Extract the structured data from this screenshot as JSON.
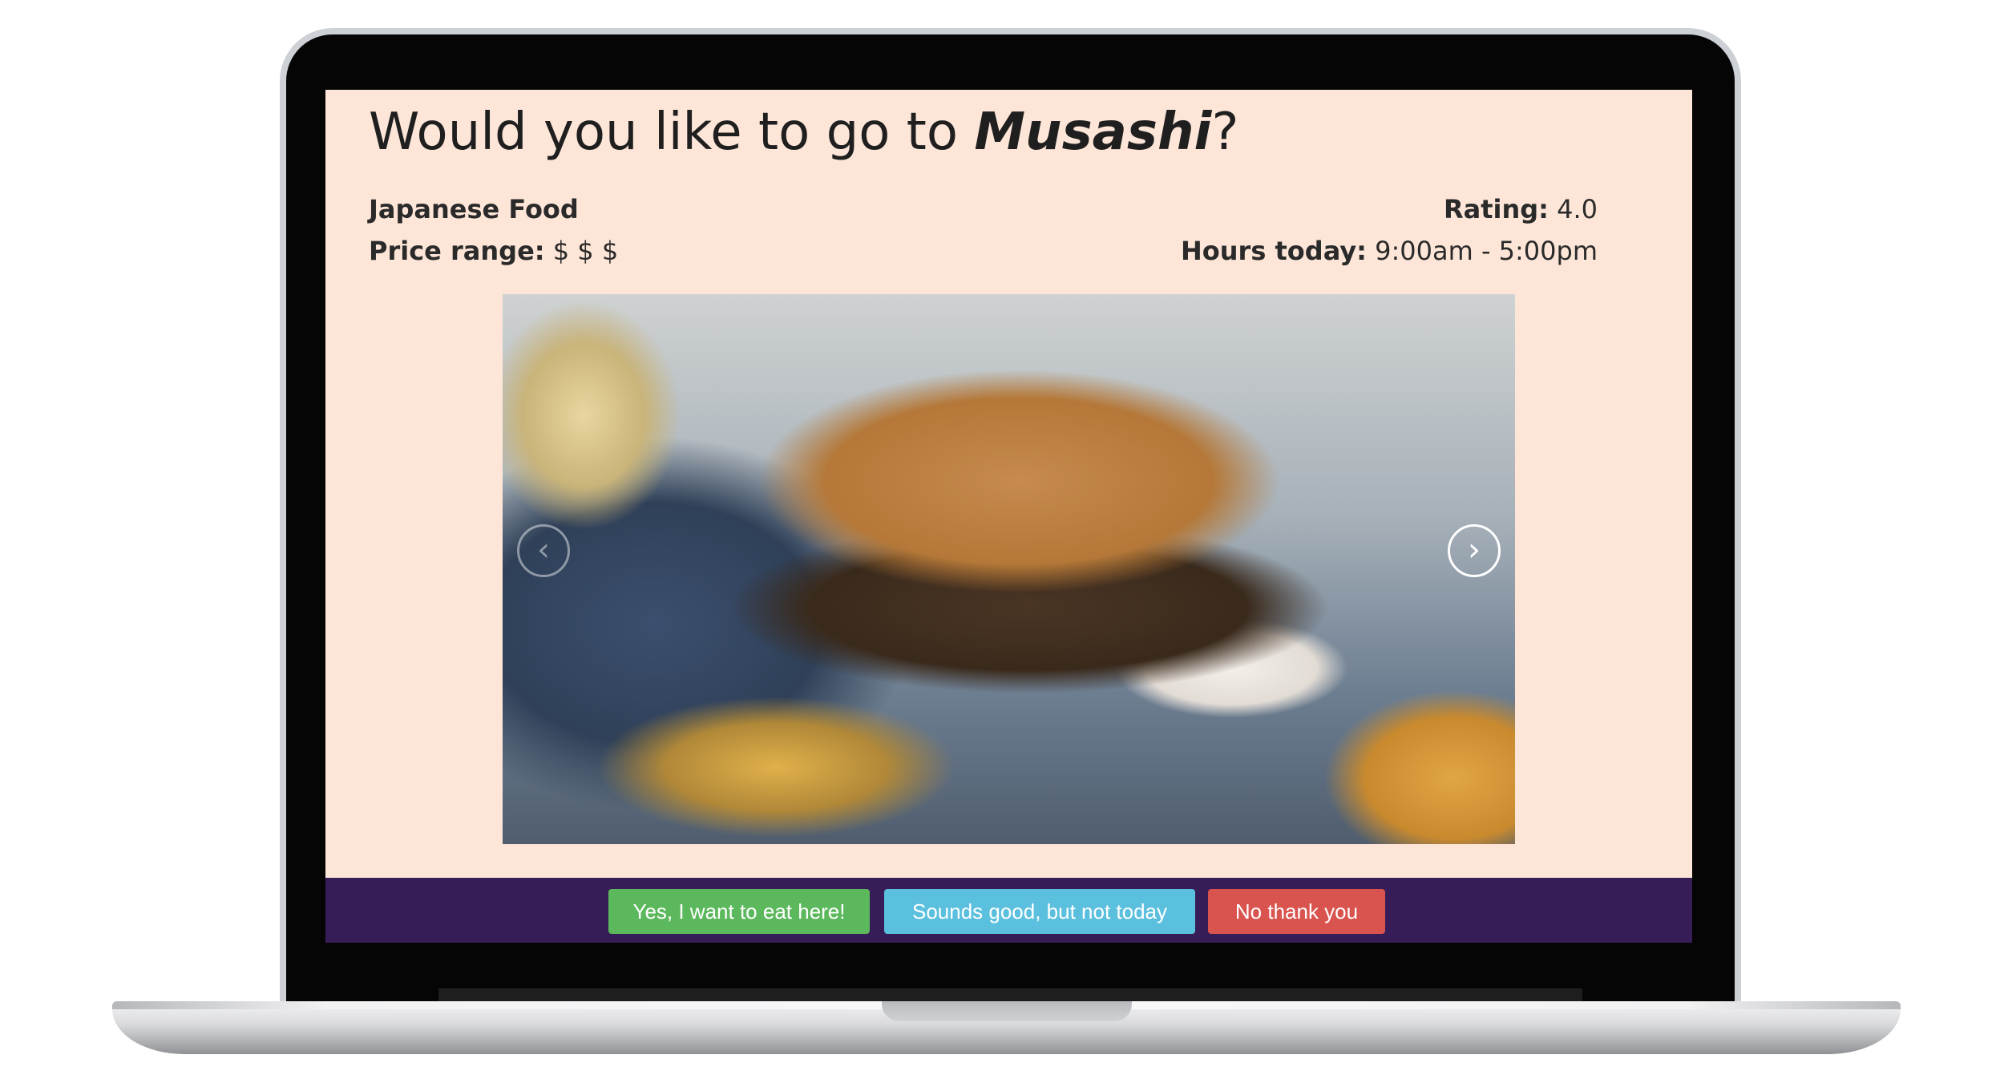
{
  "page": {
    "question_prefix": "Would you like to go to ",
    "restaurant_name": "Musashi",
    "question_suffix": "?"
  },
  "restaurant": {
    "cuisine": "Japanese Food",
    "price_label": "Price range:",
    "price_value": "$ $ $",
    "rating_label": "Rating:",
    "rating_value": "4.0",
    "hours_label": "Hours today:",
    "hours_value": "9:00am - 5:00pm"
  },
  "carousel": {
    "prev_icon": "chevron-left-icon",
    "next_icon": "chevron-right-icon",
    "prev_glyph": "‹",
    "next_glyph": "›"
  },
  "actions": {
    "yes_label": "Yes, I want to eat here!",
    "maybe_label": "Sounds good, but not today",
    "no_label": "No thank you"
  },
  "colors": {
    "content_bg": "#fde6d8",
    "action_bar_bg": "#371d57",
    "yes_button": "#5cb85c",
    "maybe_button": "#5bc0de",
    "no_button": "#d9534f"
  }
}
